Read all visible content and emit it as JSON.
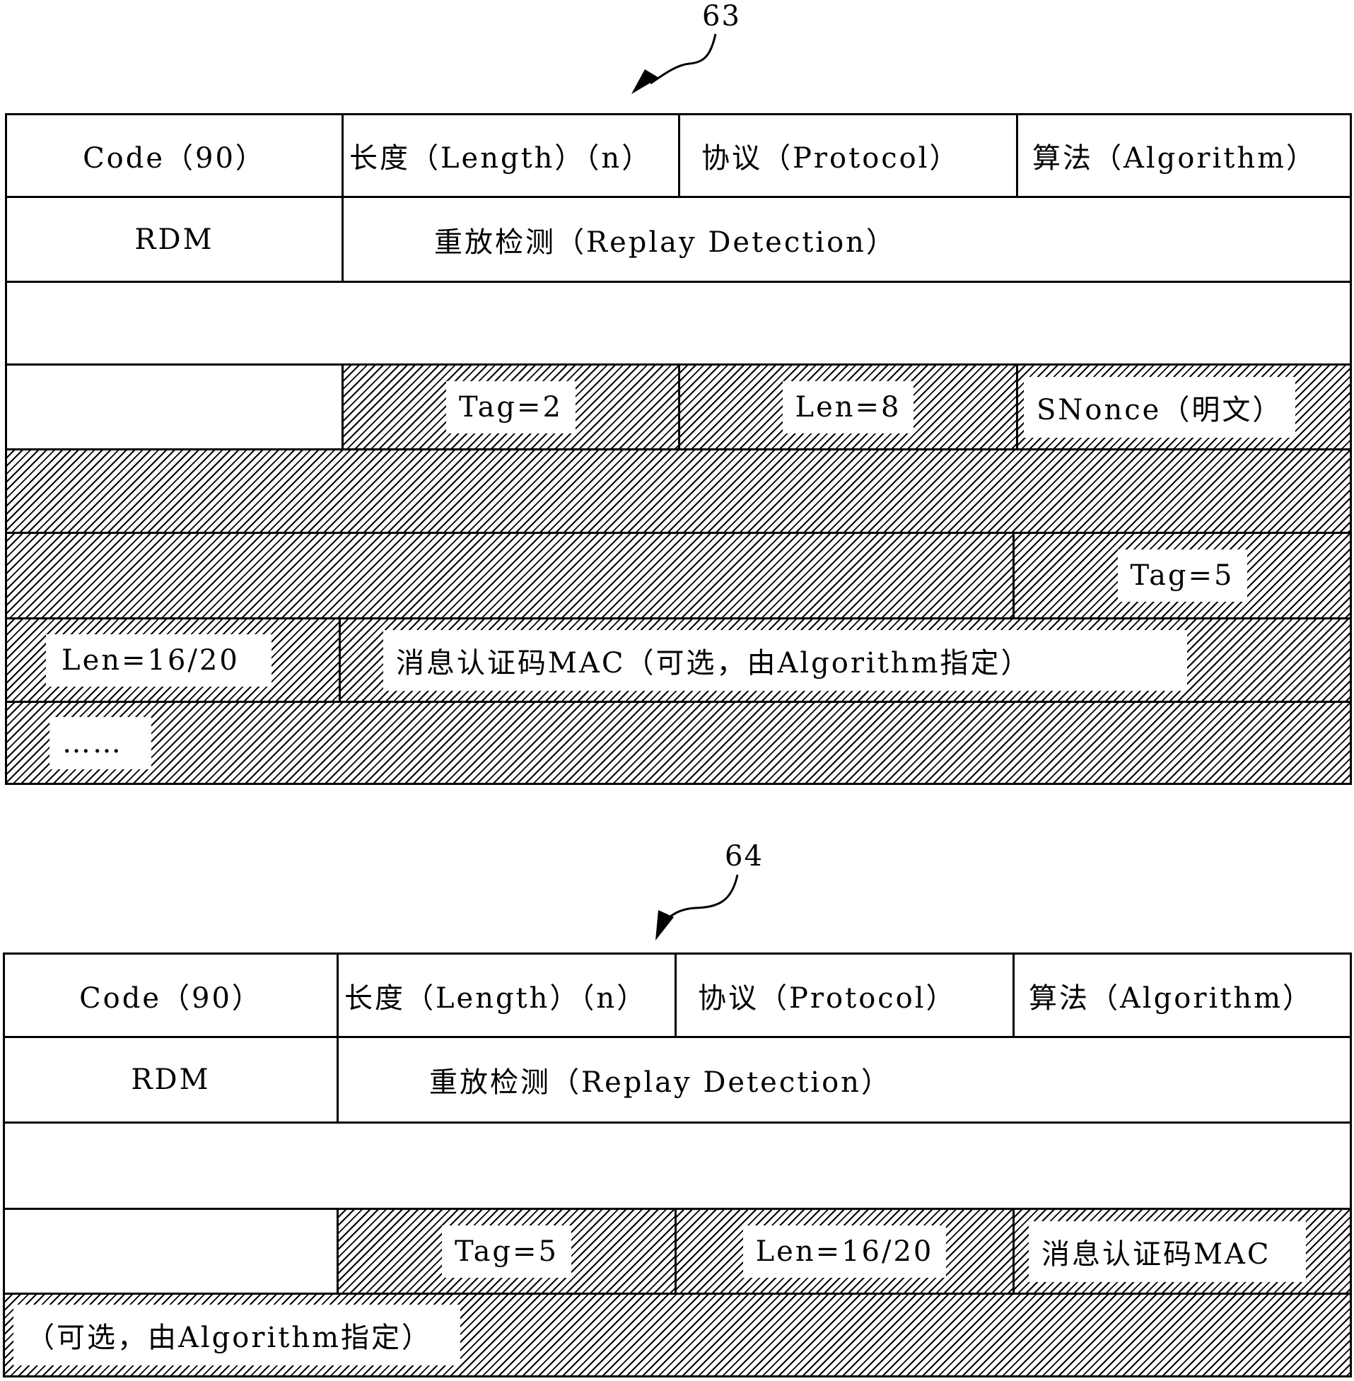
{
  "figure_63": {
    "ref": "63",
    "rows": {
      "code": "Code（90）",
      "length": "长度（Length）（n）",
      "protocol": "协议（Protocol）",
      "algorithm": "算法（Algorithm）",
      "rdm": "RDM",
      "replay": "重放检测（Replay Detection）",
      "tag2": "Tag=2",
      "len8": "Len=8",
      "snonce": "SNonce（明文）",
      "tag5": "Tag=5",
      "len1620": "Len=16/20",
      "mac": "消息认证码MAC（可选，由Algorithm指定）",
      "ellipsis": "……"
    }
  },
  "figure_64": {
    "ref": "64",
    "rows": {
      "code": "Code（90）",
      "length": "长度（Length）（n）",
      "protocol": "协议（Protocol）",
      "algorithm": "算法（Algorithm）",
      "rdm": "RDM",
      "replay": "重放检测（Replay Detection）",
      "tag5": "Tag=5",
      "len1620": "Len=16/20",
      "mac": "消息认证码MAC",
      "optional": "（可选，由Algorithm指定）"
    }
  }
}
